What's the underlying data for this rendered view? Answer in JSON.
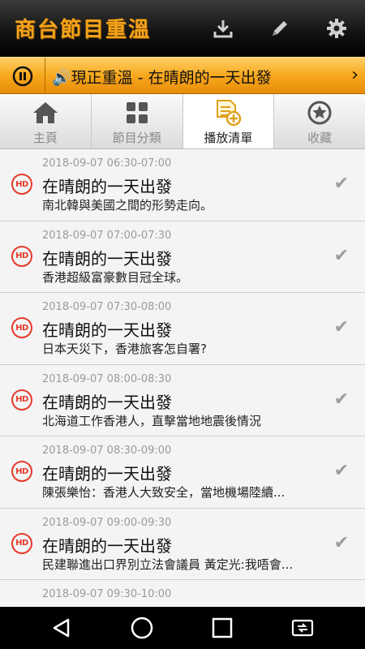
{
  "app": {
    "title": "商台節目重溫",
    "icons": [
      "download-icon",
      "pencil-icon",
      "gear-icon"
    ]
  },
  "now_playing": {
    "text": "🔊現正重溫 - 在晴朗的一天出發",
    "pause_icon": "pause-icon",
    "chevron": "›"
  },
  "tabs": [
    {
      "label": "主頁",
      "icon": "home-icon",
      "active": false
    },
    {
      "label": "節目分類",
      "icon": "grid-icon",
      "active": false
    },
    {
      "label": "播放清單",
      "icon": "playlist-add-icon",
      "active": true
    },
    {
      "label": "收藏",
      "icon": "star-icon",
      "active": false
    }
  ],
  "list": {
    "badge": "HD",
    "check_icon": "✔",
    "items": [
      {
        "time": "2018-09-07  06:30-07:00",
        "title": "在晴朗的一天出發",
        "desc": "南北韓與美國之間的形勢走向。"
      },
      {
        "time": "2018-09-07  07:00-07:30",
        "title": "在晴朗的一天出發",
        "desc": "香港超級富豪數目冠全球。"
      },
      {
        "time": "2018-09-07  07:30-08:00",
        "title": "在晴朗的一天出發",
        "desc": "日本天災下，香港旅客怎自署?"
      },
      {
        "time": "2018-09-07  08:00-08:30",
        "title": "在晴朗的一天出發",
        "desc": "北海道工作香港人，直擊當地地震後情況"
      },
      {
        "time": "2018-09-07  08:30-09:00",
        "title": "在晴朗的一天出發",
        "desc": "陳張樂怡：香港人大致安全，當地機場陸續..."
      },
      {
        "time": "2018-09-07  09:00-09:30",
        "title": "在晴朗的一天出發",
        "desc": "民建聯進出口界別立法會議員 黃定光:我唔會..."
      },
      {
        "time": "2018-09-07  09:30-10:00",
        "title": "",
        "desc": ""
      }
    ]
  },
  "navbar": {
    "icons": [
      "back-icon",
      "home-circle-icon",
      "recents-icon",
      "screen-rotate-icon"
    ]
  }
}
